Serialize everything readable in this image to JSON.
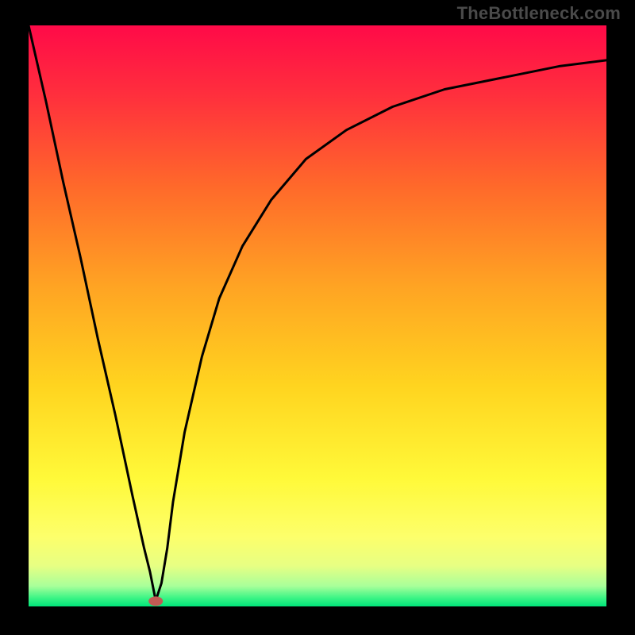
{
  "watermark": "TheBottleneck.com",
  "chart_data": {
    "type": "line",
    "title": "",
    "xlabel": "",
    "ylabel": "",
    "xlim": [
      0,
      100
    ],
    "ylim": [
      0,
      100
    ],
    "grid": false,
    "legend": false,
    "background_gradient": {
      "stops": [
        {
          "pos": 0.0,
          "color": "#ff0a48"
        },
        {
          "pos": 0.12,
          "color": "#ff2f3d"
        },
        {
          "pos": 0.28,
          "color": "#ff6a2a"
        },
        {
          "pos": 0.45,
          "color": "#ffa423"
        },
        {
          "pos": 0.62,
          "color": "#ffd41f"
        },
        {
          "pos": 0.78,
          "color": "#fff939"
        },
        {
          "pos": 0.88,
          "color": "#fdff6b"
        },
        {
          "pos": 0.93,
          "color": "#e7ff83"
        },
        {
          "pos": 0.965,
          "color": "#a8ff9a"
        },
        {
          "pos": 0.985,
          "color": "#3ef586"
        },
        {
          "pos": 1.0,
          "color": "#00e57a"
        }
      ]
    },
    "marker": {
      "x": 22,
      "y": 0.9,
      "color": "#c25a54"
    },
    "series": [
      {
        "name": "curve",
        "x": [
          0,
          3,
          6,
          9,
          12,
          15,
          18,
          20,
          21,
          22,
          23,
          24,
          25,
          27,
          30,
          33,
          37,
          42,
          48,
          55,
          63,
          72,
          82,
          92,
          100
        ],
        "y": [
          100,
          87,
          73,
          60,
          46,
          33,
          19,
          10,
          6,
          1,
          4,
          10,
          18,
          30,
          43,
          53,
          62,
          70,
          77,
          82,
          86,
          89,
          91,
          93,
          94
        ]
      }
    ]
  }
}
